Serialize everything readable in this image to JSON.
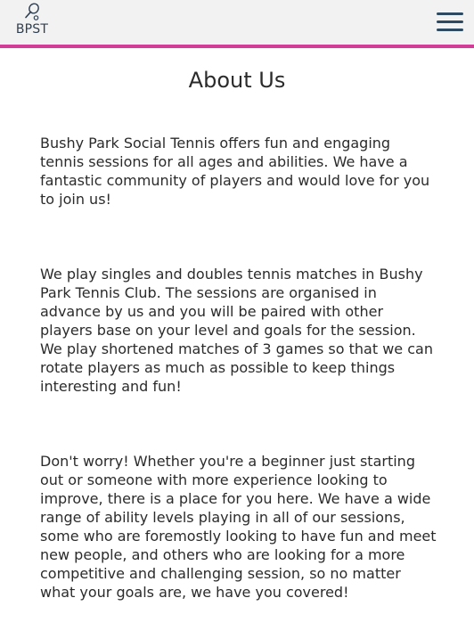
{
  "header": {
    "logo_text": "BPST",
    "logo_icon": "tennis-racket-icon",
    "menu_icon": "hamburger-menu-icon",
    "accent_color": "#d23e97"
  },
  "main": {
    "title": "About Us",
    "paragraphs": [
      "Bushy Park Social Tennis offers fun and engaging tennis sessions for all ages and abilities. We have a fantastic community of players and would love for you to join us!",
      "We play singles and doubles tennis matches in Bushy Park Tennis Club. The sessions are organised in advance by us and you will be paired with other players base on your level and goals for the session. We play shortened matches of 3 games so that we can rotate players as much as possible to keep things interesting and fun!",
      "Don't worry! Whether you're a beginner just starting out or someone with more experience looking to improve, there is a place for you here. We have a wide range of ability levels playing in all of our sessions, some who are foremostly looking to have fun and meet new people, and others who are looking for a more competitive and challenging session, so no matter what your goals are, we have you covered!"
    ]
  }
}
